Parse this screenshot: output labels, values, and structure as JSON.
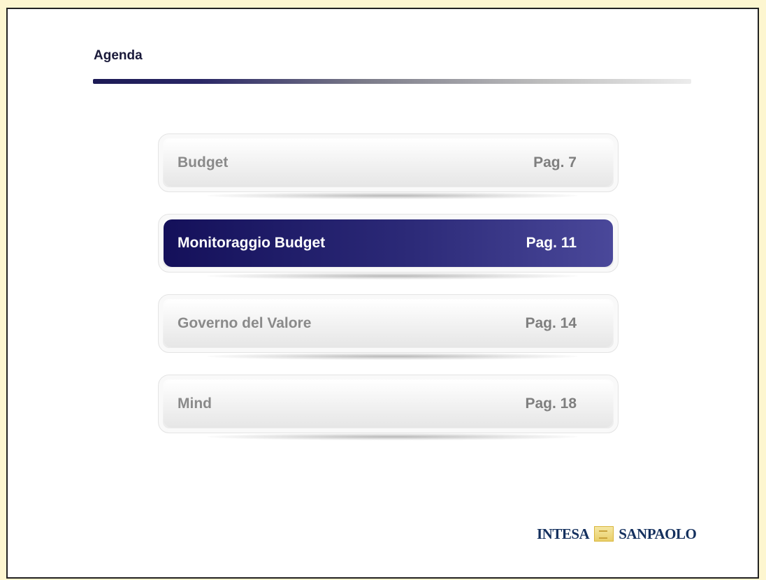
{
  "header": {
    "title": "Agenda"
  },
  "agenda": {
    "items": [
      {
        "label": "Budget",
        "page": "Pag. 7",
        "active": false
      },
      {
        "label": "Monitoraggio Budget",
        "page": "Pag. 11",
        "active": true
      },
      {
        "label": "Governo del Valore",
        "page": "Pag. 14",
        "active": false
      },
      {
        "label": "Mind",
        "page": "Pag. 18",
        "active": false
      }
    ]
  },
  "footer": {
    "logo_left": "INTESA",
    "logo_right": "SANPAOLO"
  },
  "colors": {
    "accent": "#1c1a6e",
    "brand_navy": "#14305e",
    "brand_gold": "#e9cf6a",
    "inactive_text": "#8a8a8a"
  }
}
